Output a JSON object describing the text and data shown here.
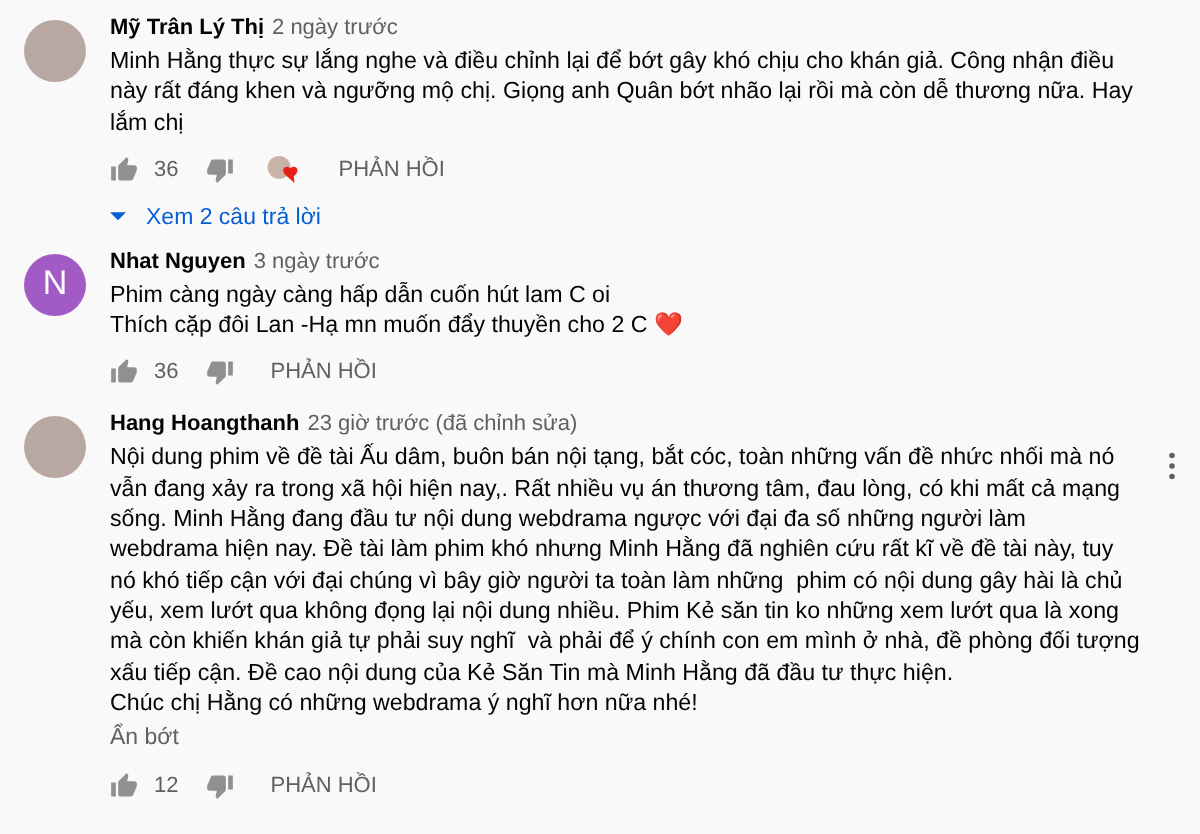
{
  "comments": [
    {
      "author": "Mỹ Trân Lý Thị",
      "time": "2 ngày trước",
      "avatar": {
        "kind": "photo"
      },
      "text": "Minh Hằng thực sự lắng nghe và điều chỉnh lại để bớt gây khó chịu cho khán giả. Công nhận điều này rất đáng khen và ngưỡng mộ chị. Giọng anh Quân bớt nhão lại rồi mà còn dễ thương nữa. Hay lắm chị",
      "likes": "36",
      "creator_heart": true,
      "reply_label": "PHẢN HỒI",
      "view_replies": "Xem 2 câu trả lời",
      "menu": false
    },
    {
      "author": "Nhat Nguyen",
      "time": "3 ngày trước",
      "avatar": {
        "kind": "letter",
        "letter": "N",
        "color": "#a25bc4"
      },
      "text": "Phim càng ngày càng hấp dẫn cuốn hút lam C oi\nThích cặp đôi Lan -Hạ mn muốn đẩy thuyền cho 2 C ❤️",
      "likes": "36",
      "creator_heart": false,
      "reply_label": "PHẢN HỒI",
      "menu": false
    },
    {
      "author": "Hang Hoangthanh",
      "time": "23 giờ trước (đã chỉnh sửa)",
      "avatar": {
        "kind": "photo"
      },
      "text": "Nội dung phim về đề tài Ấu dâm, buôn bán nội tạng, bắt cóc, toàn những vấn đề nhức nhối mà nó vẫn đang xảy ra trong xã hội hiện nay,. Rất nhiều vụ án thương tâm, đau lòng, có khi mất cả mạng sống. Minh Hằng đang đầu tư nội dung webdrama ngược với đại đa số những người làm webdrama hiện nay. Đề tài làm phim khó nhưng Minh Hằng đã nghiên cứu rất kĩ về đề tài này, tuy nó khó tiếp cận với đại chúng vì bây giờ người ta toàn làm những  phim có nội dung gây hài là chủ yếu, xem lướt qua không đọng lại nội dung nhiều. Phim Kẻ săn tin ko những xem lướt qua là xong  mà còn khiến khán giả tự phải suy nghĩ  và phải để ý chính con em mình ở nhà, đề phòng đối tượng xấu tiếp cận. Đề cao nội dung của Kẻ Săn Tin mà Minh Hằng đã đầu tư thực hiện.\nChúc chị Hằng có những webdrama ý nghĩ hơn nữa nhé!",
      "show_less": "Ẩn bớt",
      "likes": "12",
      "creator_heart": false,
      "reply_label": "PHẢN HỒI",
      "menu": true
    }
  ]
}
